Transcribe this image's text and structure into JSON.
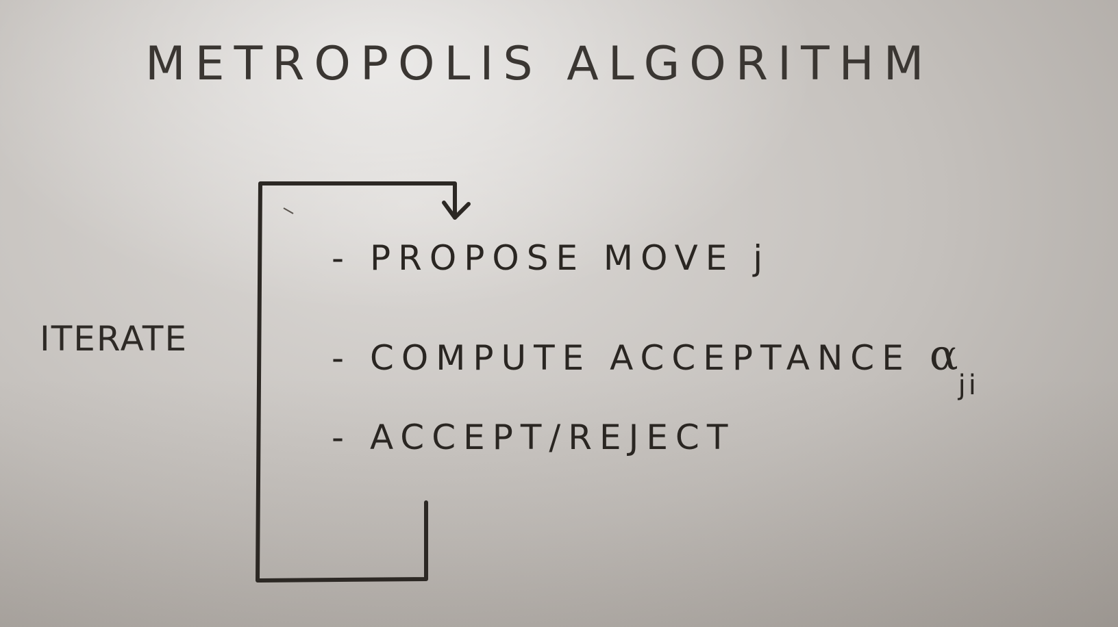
{
  "title": "METROPOLIS ALGORITHM",
  "loop_label": "ITERATE",
  "steps": [
    {
      "bullet": "-",
      "text": "PROPOSE MOVE j"
    },
    {
      "bullet": "-",
      "text": "COMPUTE ACCEPTANCE",
      "symbol": "α",
      "subscript": "ji"
    },
    {
      "bullet": "-",
      "text": "ACCEPT/REJECT"
    }
  ],
  "ink_color": "#2c2824"
}
